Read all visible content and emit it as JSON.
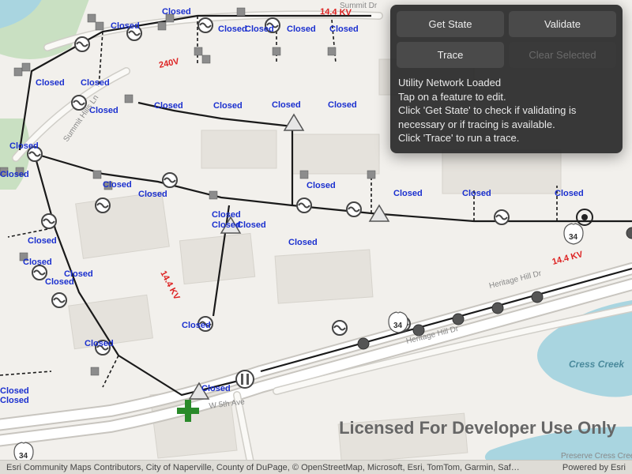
{
  "panel": {
    "buttons": {
      "get_state": "Get State",
      "validate": "Validate",
      "trace": "Trace",
      "clear_selected": "Clear Selected"
    },
    "status_lines": [
      "Utility Network Loaded",
      "Tap on a feature to edit.",
      "Click 'Get State' to check if validating is necessary or if tracing is available.",
      "Click 'Trace' to run a trace."
    ]
  },
  "watermark": "Licensed For Developer Use Only",
  "attribution_left": "Esri Community Maps Contributors, City of Naperville, County of DuPage, © OpenStreetMap, Microsoft, Esri, TomTom, Garmin, Saf…",
  "attribution_right": "Powered by Esri",
  "voltage_labels": [
    "240V",
    "14.4 KV",
    "14.4 KV"
  ],
  "street_labels": {
    "summit_hills": "Summit Hills Ln",
    "summit_dr": "Summit Dr",
    "heritage_top": "Heritage Hill Dr",
    "heritage_bot": "Heritage Hill Dr",
    "w5th": "W 5th Ave",
    "preserve": "Preserve Cress Creek"
  },
  "water_label": "Cress Creek",
  "highway_shield": "34",
  "feature_state_label": "Closed"
}
